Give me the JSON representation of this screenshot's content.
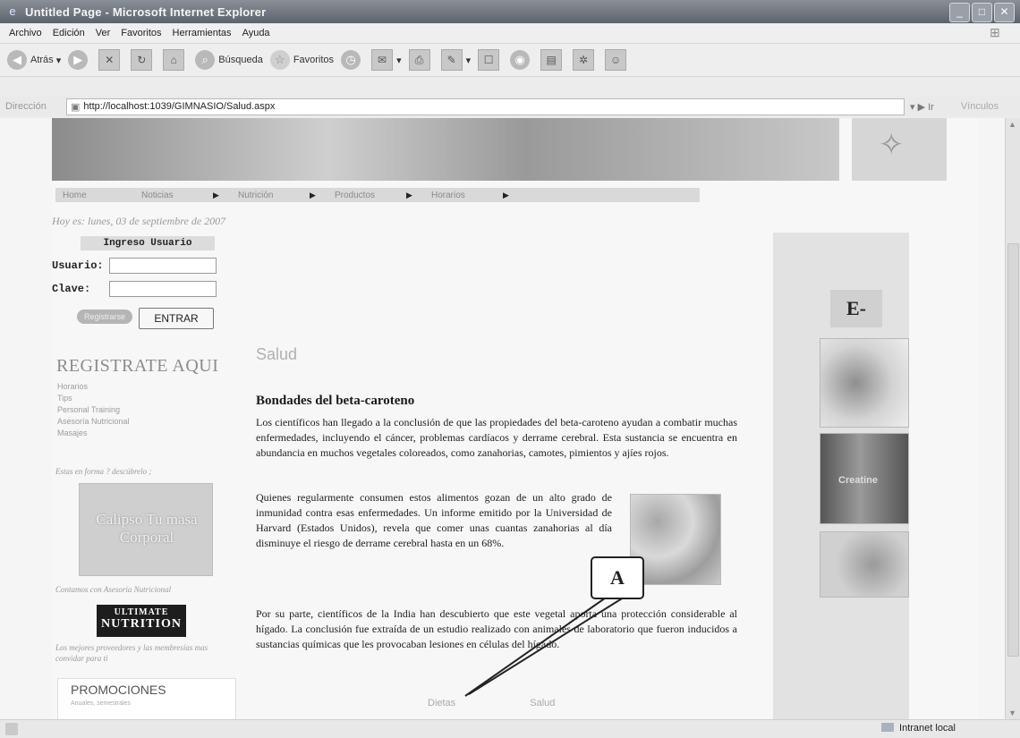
{
  "window": {
    "title": "Untitled Page - Microsoft Internet Explorer"
  },
  "menu": [
    "Archivo",
    "Edición",
    "Ver",
    "Favoritos",
    "Herramientas",
    "Ayuda"
  ],
  "toolbar": {
    "back_label": "Atrás",
    "search_label": "Búsqueda",
    "favorites_label": "Favoritos"
  },
  "address": {
    "label": "Dirección",
    "url": "http://localhost:1039/GIMNASIO/Salud.aspx",
    "go_label": "Ir",
    "links_label": "Vínculos"
  },
  "page": {
    "nav": [
      "Home",
      "Noticias",
      "Nutrición",
      "Productos",
      "Horarios"
    ],
    "date": "Hoy es: lunes, 03 de septiembre de 2007",
    "login": {
      "title": "Ingreso Usuario",
      "user_label": "Usuario:",
      "pass_label": "Clave:",
      "graphic_button": "Registrarse",
      "submit_label": "ENTRAR"
    },
    "register": "REGISTRATE AQUI",
    "left_links": [
      "Horarios",
      "Tips",
      "Personal Training",
      "Asesoría Nutricional",
      "Masajes"
    ],
    "left_tagline": "Estas en forma ? descúbrelo ;",
    "calipso_label": "Calipso Tu masa Corporal",
    "advice_tag": "Contamos con Asesoría Nutricional",
    "brand": {
      "line1": "ULTIMATE",
      "line2": "NUTRITION"
    },
    "brand_tag": "Los mejores proveedores y las membresías mas convidar para ti",
    "promo": {
      "title": "PROMOCIONES",
      "subtitle": "Anuales, semestrales"
    },
    "section_title": "Salud",
    "article": {
      "title": "Bondades del beta-caroteno",
      "p1": "Los científicos han llegado a la conclusión de que las propiedades del beta-caroteno ayudan a combatir muchas enfermedades, incluyendo el cáncer, problemas cardíacos y derrame cerebral. Esta sustancia se encuentra en abundancia en muchos vegetales coloreados, como zanahorias, camotes, pimientos y ajíes rojos.",
      "p2": "Quienes regularmente consumen estos alimentos gozan de un alto grado de inmunidad contra esas enfermedades. Un informe emitido por la Universidad de Harvard (Estados Unidos), revela que comer unas cuantas zanahorias al día disminuye el riesgo de derrame cerebral hasta en un 68%.",
      "p3": "Por su parte, científicos de la India han descubierto que este vegetal aporta una protección considerable al hígado. La conclusión fue extraída de un estudio realizado con animales de laboratorio que fueron inducidos a sustancias químicas que les provocaban lesiones en células del hígado."
    },
    "footer_links": [
      "Dietas",
      "Salud"
    ],
    "email_label": "E-MAIL",
    "product_label": "Creatine"
  },
  "annotation": {
    "label": "A"
  },
  "status": {
    "zone": "Intranet local"
  }
}
